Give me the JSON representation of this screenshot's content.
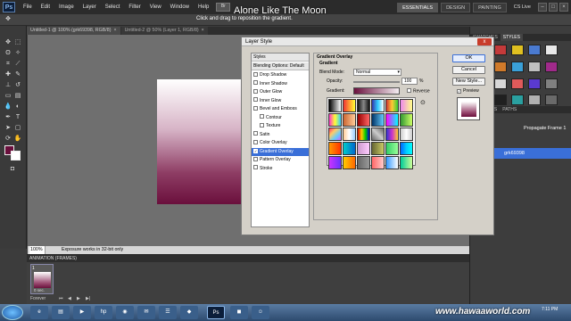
{
  "app": {
    "logo": "Ps"
  },
  "menu": [
    "File",
    "Edit",
    "Image",
    "Layer",
    "Select",
    "Filter",
    "View",
    "Window",
    "Help"
  ],
  "menu_zoom": "Br",
  "workspace": {
    "buttons": [
      "ESSENTIALS",
      "DESIGN",
      "PAINTING"
    ],
    "active": "ESSENTIALS",
    "cslive": "CS Live"
  },
  "options_bar": {
    "hint": "Click and drag to reposition the gradient."
  },
  "overlay_title": "Alone Like The Moon",
  "doc_tabs": [
    {
      "label": "Untitled-1 @ 100% (grk69398, RGB/8)",
      "close": "×",
      "active": true
    },
    {
      "label": "Untitled-2 @ 50% (Layer 1, RGB/8)",
      "close": "×",
      "active": false
    }
  ],
  "status": {
    "zoom": "100%",
    "message": "Exposure works in 32-bit only"
  },
  "animation": {
    "header": "ANIMATION (FRAMES)",
    "frame_number": "1",
    "frame_delay": "0 sec.",
    "loop": "Forever"
  },
  "right_panel": {
    "top_tabs": [
      "SWATCHES",
      "STYLES"
    ],
    "active_tab": "STYLES",
    "layer_tabs": [
      "CHANNELS",
      "PATHS"
    ],
    "propagate": "Propagate Frame 1",
    "layer_name": "grk69398"
  },
  "style_colors": [
    "#2a2a2a",
    "#c43a3a",
    "#e0c020",
    "#4a7ad0",
    "#e8e8e8",
    "#8a2a2a",
    "#d07a2a",
    "#3aa0d8",
    "#c0c0c0",
    "#a02a8a",
    "#2a6a2a",
    "#d8d8d8",
    "#e05a5a",
    "#5a3ad0",
    "#808080",
    "#f0a020",
    "#202020",
    "#2aa0a0",
    "#b0b0b0",
    "#6a6a6a"
  ],
  "dialog": {
    "title": "Layer Style",
    "close": "x",
    "styles_header": "Styles",
    "blending": "Blending Options: Default",
    "effects": [
      {
        "label": "Drop Shadow",
        "checked": false,
        "indent": false
      },
      {
        "label": "Inner Shadow",
        "checked": false,
        "indent": false
      },
      {
        "label": "Outer Glow",
        "checked": false,
        "indent": false
      },
      {
        "label": "Inner Glow",
        "checked": false,
        "indent": false
      },
      {
        "label": "Bevel and Emboss",
        "checked": false,
        "indent": false
      },
      {
        "label": "Contour",
        "checked": false,
        "indent": true
      },
      {
        "label": "Texture",
        "checked": false,
        "indent": true
      },
      {
        "label": "Satin",
        "checked": false,
        "indent": false
      },
      {
        "label": "Color Overlay",
        "checked": false,
        "indent": false
      },
      {
        "label": "Gradient Overlay",
        "checked": true,
        "indent": false
      },
      {
        "label": "Pattern Overlay",
        "checked": false,
        "indent": false
      },
      {
        "label": "Stroke",
        "checked": false,
        "indent": false
      }
    ],
    "selected": "Gradient Overlay",
    "group_title": "Gradient Overlay",
    "sub_title": "Gradient",
    "blend_mode_label": "Blend Mode:",
    "blend_mode_value": "Normal",
    "opacity_label": "Opacity:",
    "opacity_value": "100",
    "opacity_unit": "%",
    "gradient_label": "Gradient:",
    "reverse_label": "Reverse",
    "buttons": {
      "ok": "OK",
      "cancel": "Cancel",
      "new_style": "New Style..."
    },
    "preview_label": "Preview",
    "preview_checked": true,
    "gradient_presets": [
      "linear-gradient(90deg,#000,#fff)",
      "linear-gradient(90deg,#e33,#f93,#ff3)",
      "linear-gradient(90deg,#111,#888,#111)",
      "linear-gradient(90deg,#33a,#3cf,#fff)",
      "linear-gradient(90deg,#c33,#fc3,#3c3)",
      "linear-gradient(90deg,#e8e,#ff8)",
      "linear-gradient(90deg,#f3c,#ff3,#3cf)",
      "linear-gradient(90deg,#c63,#fc9)",
      "linear-gradient(90deg,#900,#f66)",
      "linear-gradient(90deg,#036,#6cf)",
      "linear-gradient(90deg,#f0f,#0ff)",
      "linear-gradient(90deg,#393,#cf6)",
      "linear-gradient(135deg,#f36,#fc6,#6cf,#c6f)",
      "linear-gradient(90deg,#fc9,#fff,#9cf)",
      "linear-gradient(90deg,#c00,#fc0,#0c0,#00c)",
      "linear-gradient(45deg,#666,#ccc,#666)",
      "linear-gradient(90deg,#33c,#c3c,#fc3)",
      "linear-gradient(90deg,#ccc,#fff,#ccc)",
      "linear-gradient(90deg,#f90,#f30)",
      "linear-gradient(90deg,#0cc,#06c)",
      "linear-gradient(90deg,#c9c,#fcf)",
      "linear-gradient(90deg,#663,#cc6)",
      "linear-gradient(90deg,#3c6,#9f9)",
      "linear-gradient(90deg,#06f,#0cf,#0ff)",
      "linear-gradient(90deg,#c3f,#63f)",
      "linear-gradient(90deg,#fc0,#f60)",
      "linear-gradient(90deg,#666,#999)",
      "linear-gradient(90deg,#f66,#fcc)",
      "linear-gradient(90deg,#39f,#9cf,#fff)",
      "linear-gradient(90deg,#0c9,#cf9)"
    ]
  },
  "taskbar": {
    "watermark": "www.hawaaworld.com",
    "clock": "7:11 PM"
  }
}
